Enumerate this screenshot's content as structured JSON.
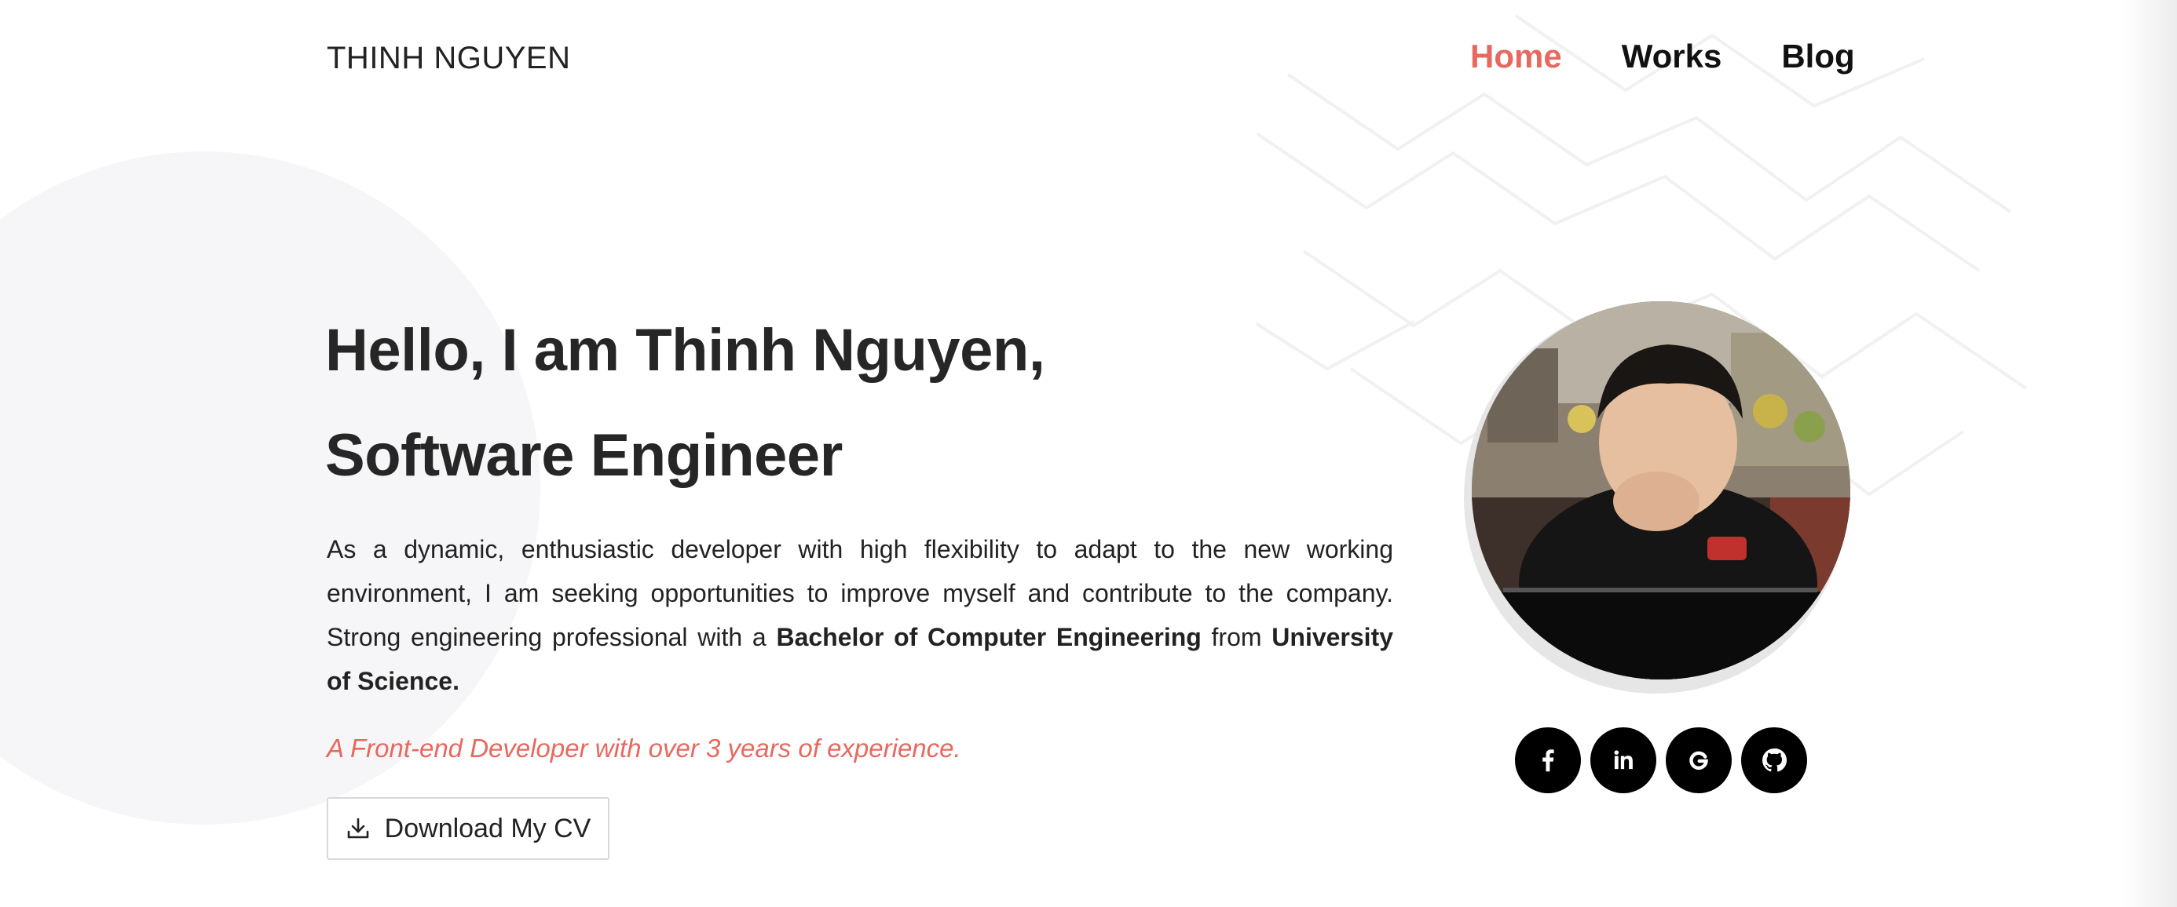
{
  "header": {
    "logo": "THINH NGUYEN",
    "nav": [
      {
        "label": "Home",
        "active": true
      },
      {
        "label": "Works",
        "active": false
      },
      {
        "label": "Blog",
        "active": false
      }
    ]
  },
  "hero": {
    "title_line1": "Hello, I am Thinh Nguyen,",
    "title_line2": "Software Engineer",
    "intro_part1": "As a dynamic, enthusiastic developer with high flexibility to adapt to the new working environment, I am seeking opportunities to improve myself and contribute to the company. Strong engineering professional with a ",
    "intro_degree": "Bachelor of Computer Engineering",
    "intro_part2": " from ",
    "intro_school": "University of Science.",
    "tagline": "A Front-end Developer with over 3 years of experience.",
    "cv_button_label": "Download My CV"
  },
  "social": [
    {
      "name": "facebook-icon"
    },
    {
      "name": "linkedin-icon"
    },
    {
      "name": "google-icon"
    },
    {
      "name": "github-icon"
    }
  ],
  "colors": {
    "accent": "#e8685f",
    "text": "#222222",
    "social_bg": "#000000"
  }
}
